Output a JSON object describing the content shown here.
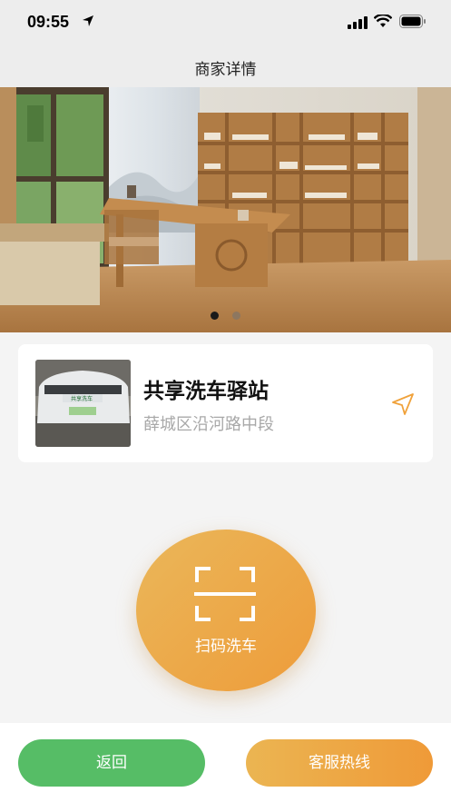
{
  "status_bar": {
    "time": "09:55"
  },
  "nav": {
    "title": "商家详情"
  },
  "banner": {
    "slide_count": 2,
    "active_index": 0
  },
  "merchant": {
    "name": "共享洗车驿站",
    "address": "薛城区沿河路中段",
    "thumb_plate_text": "共享洗车"
  },
  "scan": {
    "label": "扫码洗车"
  },
  "actions": {
    "back_label": "返回",
    "service_label": "客服热线"
  },
  "colors": {
    "green": "#56bd66",
    "orange_start": "#ebb552",
    "orange_end": "#ef9a38"
  },
  "icons": [
    "location-arrow-icon",
    "signal-icon",
    "wifi-icon",
    "battery-icon",
    "navigate-icon",
    "scan-icon"
  ]
}
